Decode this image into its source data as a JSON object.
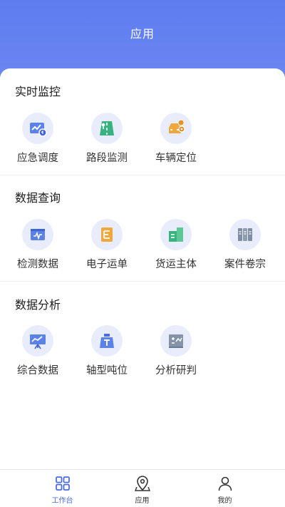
{
  "header": {
    "title": "应用"
  },
  "sections": [
    {
      "title": "实时监控",
      "items": [
        {
          "label": "应急调度",
          "icon": "emergency-dispatch-icon"
        },
        {
          "label": "路段监测",
          "icon": "road-monitor-icon"
        },
        {
          "label": "车辆定位",
          "icon": "vehicle-location-icon"
        }
      ]
    },
    {
      "title": "数据查询",
      "items": [
        {
          "label": "检测数据",
          "icon": "detection-data-icon"
        },
        {
          "label": "电子运单",
          "icon": "e-waybill-icon"
        },
        {
          "label": "货运主体",
          "icon": "freight-entity-icon"
        },
        {
          "label": "案件卷宗",
          "icon": "case-file-icon"
        }
      ]
    },
    {
      "title": "数据分析",
      "items": [
        {
          "label": "综合数据",
          "icon": "comprehensive-data-icon"
        },
        {
          "label": "轴型吨位",
          "icon": "axle-tonnage-icon"
        },
        {
          "label": "分析研判",
          "icon": "analysis-judgment-icon"
        }
      ]
    }
  ],
  "tabbar": {
    "items": [
      {
        "label": "工作台",
        "icon": "workbench-icon",
        "active": true
      },
      {
        "label": "应用",
        "icon": "location-icon",
        "active": false
      },
      {
        "label": "我的",
        "icon": "user-icon",
        "active": false
      }
    ]
  },
  "colors": {
    "header": "#6381ef",
    "accent": "#4a6ee0",
    "icon_bg": "#e9edfb"
  }
}
